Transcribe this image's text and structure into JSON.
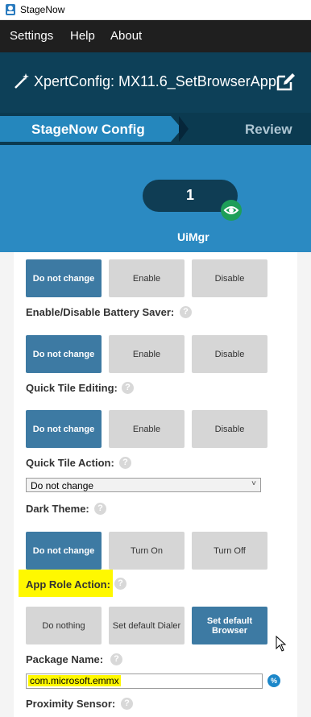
{
  "window": {
    "title": "StageNow"
  },
  "menu": {
    "items": [
      "Settings",
      "Help",
      "About"
    ]
  },
  "header": {
    "title": "XpertConfig: MX11.6_SetBrowserApp"
  },
  "tabs": {
    "config": "StageNow Config",
    "review": "Review"
  },
  "step": {
    "count": "1",
    "name": "UiMgr"
  },
  "sections": {
    "top_buttons": [
      "Do not change",
      "Enable",
      "Disable"
    ],
    "battery_saver": {
      "label": "Enable/Disable Battery Saver:",
      "buttons": [
        "Do not change",
        "Enable",
        "Disable"
      ],
      "selected": "Do not change"
    },
    "quick_tile_editing": {
      "label": "Quick Tile Editing:",
      "buttons": [
        "Do not change",
        "Enable",
        "Disable"
      ],
      "selected": "Do not change"
    },
    "quick_tile_action": {
      "label": "Quick Tile Action:",
      "value": "Do not change"
    },
    "dark_theme": {
      "label": "Dark Theme:",
      "buttons": [
        "Do not change",
        "Turn On",
        "Turn Off"
      ],
      "selected": "Do not change"
    },
    "app_role_action": {
      "label": "App Role Action:",
      "buttons": [
        "Do nothing",
        "Set default Dialer",
        "Set default Browser"
      ],
      "selected": "Set default Browser"
    },
    "package_name": {
      "label": "Package Name:",
      "value": "com.microsoft.emmx"
    },
    "proximity_sensor": {
      "label": "Proximity Sensor:"
    }
  },
  "help_glyph": "?",
  "percent_glyph": "%",
  "colors": {
    "accent": "#2587bd",
    "header": "#0d4058",
    "selected_button": "#3d7aa3",
    "highlight": "#fff800"
  }
}
